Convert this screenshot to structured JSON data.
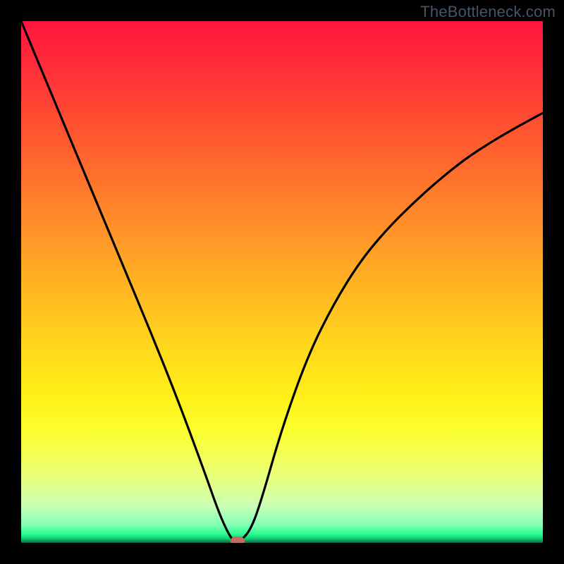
{
  "watermark": "TheBottleneck.com",
  "colors": {
    "frame": "#000000",
    "curve": "#000000",
    "marker": "#c96a5e"
  },
  "chart_data": {
    "type": "line",
    "title": "",
    "xlabel": "",
    "ylabel": "",
    "xlim": [
      0,
      100
    ],
    "ylim": [
      0,
      100
    ],
    "grid": false,
    "legend": false,
    "series": [
      {
        "name": "bottleneck-curve",
        "x": [
          0,
          5,
          10,
          15,
          20,
          25,
          30,
          35,
          38,
          40,
          41,
          42,
          44,
          46,
          50,
          55,
          60,
          65,
          70,
          75,
          80,
          85,
          90,
          95,
          100
        ],
        "values": [
          100,
          88,
          76,
          64,
          52,
          40,
          27.5,
          14,
          5.5,
          1.2,
          0.3,
          0.3,
          2.5,
          8,
          22,
          36,
          46,
          54,
          60,
          65,
          69.5,
          73.5,
          76.8,
          79.7,
          82.4
        ]
      }
    ],
    "marker": {
      "x": 41.5,
      "y": 0.25
    },
    "gradient_stops": [
      {
        "pos": 0.0,
        "color": "#ff163e"
      },
      {
        "pos": 0.5,
        "color": "#ffb022"
      },
      {
        "pos": 0.78,
        "color": "#fdff2c"
      },
      {
        "pos": 0.965,
        "color": "#84ffb5"
      },
      {
        "pos": 1.0,
        "color": "#07693d"
      }
    ]
  }
}
